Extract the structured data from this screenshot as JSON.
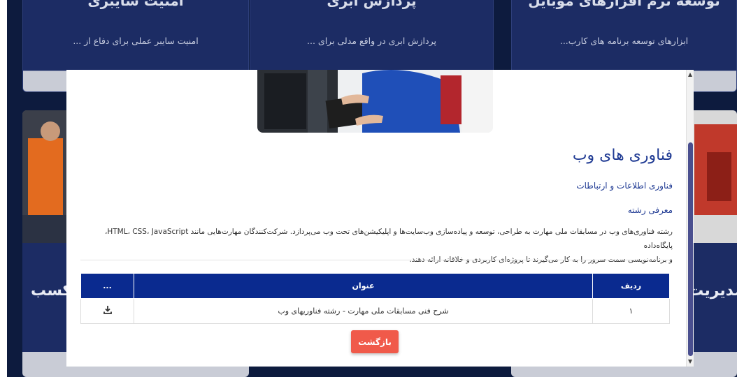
{
  "cards_top": [
    {
      "title": "امنیت سایبری",
      "desc": "امنیت سایبر عملی برای دفاع از ..."
    },
    {
      "title": "پردازش ابری",
      "desc": "پردازش ابری در واقع مدلی برای ..."
    },
    {
      "title": "توسعه نرم افزارهای موبایل",
      "desc": "ابزارهای توسعه برنامه های کارب..."
    }
  ],
  "cards_mid": [
    {
      "title": "کسب"
    },
    {
      "title": "مدیریت"
    }
  ],
  "modal": {
    "title": "فناوری های وب",
    "category": "فناوری اطلاعات و ارتباطات",
    "section_heading": "معرفی رشته",
    "body_line1": "رشته فناوری‌های وب در مسابقات ملی مهارت به طراحی، توسعه و پیاده‌سازی وب‌سایت‌ها و اپلیکیشن‌های تحت وب می‌پردازد. شرکت‌کنندگان مهارت‌هایی مانند HTML، CSS، JavaScript، پایگاه‌داده",
    "body_line2": "و برنامه‌نویسی سمت سرور را به کار می‌گیرند تا پروژه‌ای کاربردی و خلاقانه ارائه دهند.",
    "table": {
      "headers": {
        "index": "ردیف",
        "title": "عنوان",
        "action": "..."
      },
      "rows": [
        {
          "index": "۱",
          "title": "شرح فنی مسابقات ملی مهارت - رشته فناوریهای وب",
          "action_icon": "download-icon"
        }
      ]
    },
    "back_label": "بازگشت"
  },
  "colors": {
    "page_bg": "#0d1b3e",
    "card_bg": "#1c2c64",
    "accent_blue": "#1f3a93",
    "table_header": "#0a2a8f",
    "back_button": "#f05a4a",
    "scroll_thumb": "#4a4f8f"
  }
}
